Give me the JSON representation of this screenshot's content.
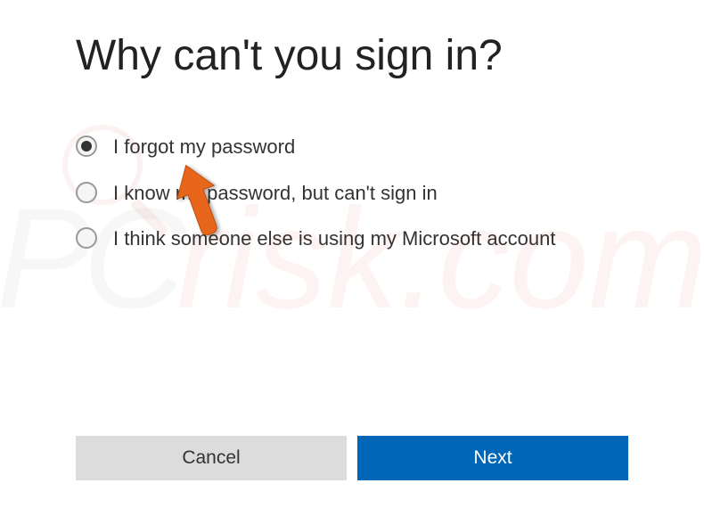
{
  "title": "Why can't you sign in?",
  "options": [
    {
      "label": "I forgot my password",
      "selected": true
    },
    {
      "label": "I know my password, but can't sign in",
      "selected": false
    },
    {
      "label": "I think someone else is using my Microsoft account",
      "selected": false
    }
  ],
  "buttons": {
    "cancel": "Cancel",
    "next": "Next"
  },
  "watermark": {
    "text1": "PC",
    "text2": "risk",
    "text3": ".com"
  },
  "annotation": {
    "cursor_arrow_color": "#e8651a"
  }
}
